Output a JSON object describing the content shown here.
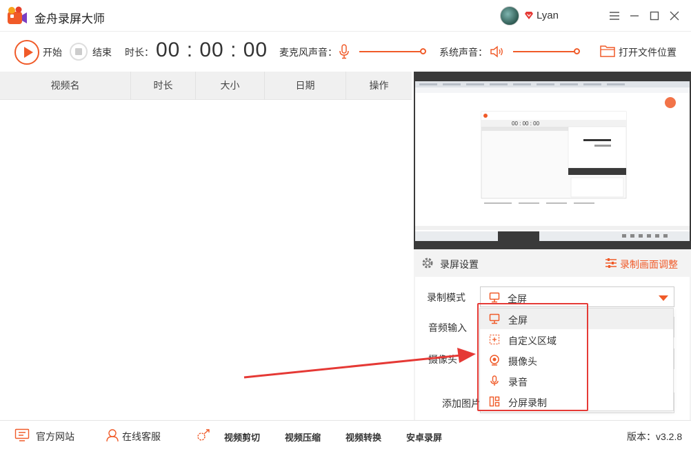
{
  "app": {
    "title": "金舟录屏大师"
  },
  "user": {
    "name": "Lyan"
  },
  "toolbar": {
    "start_label": "开始",
    "stop_label": "结束",
    "duration_label": "时长：",
    "duration_value": "00 : 00 : 00",
    "mic_label": "麦克风声音：",
    "system_label": "系统声音：",
    "open_folder_label": "打开文件位置"
  },
  "table": {
    "headers": [
      "视频名",
      "时长",
      "大小",
      "日期",
      "操作"
    ],
    "rows": []
  },
  "settings": {
    "title": "录屏设置",
    "adjust_label": "录制画面调整",
    "mode_label": "录制模式",
    "mode_value": "全屏",
    "audio_label": "音频输入",
    "camera_label": "摄像头",
    "image_label": "添加图片"
  },
  "dropdown": {
    "items": [
      {
        "label": "全屏",
        "icon": "monitor-icon",
        "selected": true
      },
      {
        "label": "自定义区域",
        "icon": "custom-area-icon",
        "selected": false
      },
      {
        "label": "摄像头",
        "icon": "camera-icon",
        "selected": false
      },
      {
        "label": "录音",
        "icon": "mic-icon",
        "selected": false
      },
      {
        "label": "分屏录制",
        "icon": "split-screen-icon",
        "selected": false
      }
    ]
  },
  "footer": {
    "website": "官方网站",
    "support": "在线客服",
    "links": [
      "视频剪切",
      "视频压缩",
      "视频转换",
      "安卓录屏"
    ],
    "version": "版本：v3.2.8"
  },
  "colors": {
    "accent": "#f05a28",
    "annotation": "#e53935"
  }
}
